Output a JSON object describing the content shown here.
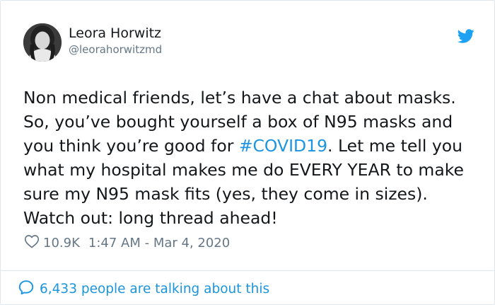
{
  "user": {
    "name": "Leora Horwitz",
    "handle": "@leorahorwitzmd"
  },
  "tweet": {
    "line1": "Non medical friends, let’s have a chat about masks.",
    "line2": "So, you’ve bought yourself a box of N95 masks and",
    "line3_before": "you think you’re good for ",
    "hashtag": "#COVID19",
    "line3_after": ". Let me tell you",
    "line4": "what my hospital makes me do EVERY YEAR to make",
    "line5": "sure my N95 mask fits (yes, they come in sizes).",
    "line6": "Watch out: long thread ahead!"
  },
  "meta": {
    "likes": "10.9K",
    "timestamp": "1:47 AM - Mar 4, 2020"
  },
  "conversation": {
    "label": "6,433 people are talking about this"
  },
  "icons": {
    "brand": "twitter-bird-icon",
    "like": "heart-icon",
    "reply": "speech-bubble-icon"
  },
  "colors": {
    "accent": "#1b95e0",
    "text": "#14171a",
    "muted": "#657786",
    "border": "#e1e8ed"
  }
}
